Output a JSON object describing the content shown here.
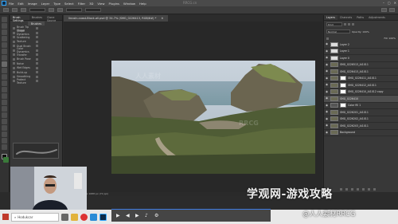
{
  "menubar": {
    "items": [
      "File",
      "Edit",
      "Image",
      "Layer",
      "Type",
      "Select",
      "Filter",
      "3D",
      "View",
      "Plugins",
      "Window",
      "Help"
    ],
    "center_watermark": "RRCG.cn"
  },
  "left_panel": {
    "tabs": [
      "Brush Settings",
      "Brushes",
      "Clone Source"
    ],
    "header": "Brushes",
    "settings": [
      "Brush Tip Shape",
      "Shape Dynamics",
      "Scattering",
      "Texture",
      "Dual Brush",
      "Color Dynamics",
      "Transfer",
      "Brush Pose",
      "Noise",
      "Wet Edges",
      "Build-up",
      "Smoothing",
      "Protect Texture"
    ]
  },
  "document": {
    "tab_title": "lincoln-coast-Block-all.psd @ 34.7% (SMG_0226413, RGB/8#) *",
    "status": "34.72%   3000 px x 1688 px (72 ppi)"
  },
  "right_panel": {
    "tabs": [
      "Layers",
      "Channels",
      "Paths",
      "Adjustments"
    ],
    "filter_label": "Kind",
    "blend_mode": "Normal",
    "opacity_label": "Opacity: 100%",
    "fill_label": "Fill: 100%",
    "layers": [
      {
        "name": "Layer 2",
        "type": "light"
      },
      {
        "name": "Layer 1",
        "type": "light"
      },
      {
        "name": "Layer 0",
        "type": "light"
      },
      {
        "name": "SMG_0226513_AI1011",
        "type": "photo"
      },
      {
        "name": "SMG_0226413_AI1011",
        "type": "photo"
      },
      {
        "name": "SMG_0226411_AI1011",
        "type": "photo",
        "mask": true
      },
      {
        "name": "SMG_0226412_AI1011",
        "type": "photo",
        "mask": true
      },
      {
        "name": "SMG_0226410_AI1012 copy",
        "type": "photo",
        "mask": true
      },
      {
        "name": "SMG_0226410",
        "type": "photo",
        "selected": true
      },
      {
        "name": "Color fill 1",
        "type": "dark",
        "mask": true
      },
      {
        "name": "SMG_0226201_AI1011",
        "type": "photo"
      },
      {
        "name": "SMG_0226202_AI1011",
        "type": "photo"
      },
      {
        "name": "SMG_0226203_AI1011",
        "type": "photo"
      },
      {
        "name": "Background",
        "type": "photo"
      }
    ]
  },
  "taskbar": {
    "search_placeholder": "Hodukcar"
  },
  "watermarks": {
    "main": "学观网-游戏攻略",
    "bottom": "@人人素材RRCG"
  },
  "colors": {
    "accent": "#3d7ae0",
    "ps_bg": "#2b2b2b",
    "panel": "#383838"
  }
}
